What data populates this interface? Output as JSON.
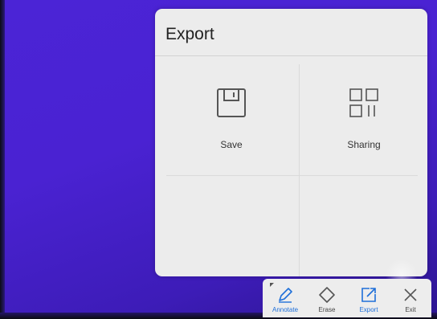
{
  "panel": {
    "title": "Export",
    "options": [
      {
        "label": "Save",
        "icon": "floppy-disk-icon"
      },
      {
        "label": "Sharing",
        "icon": "sharing-grid-icon"
      }
    ]
  },
  "toolbar": {
    "items": [
      {
        "label": "Annotate",
        "icon": "pen-icon",
        "active": true
      },
      {
        "label": "Erase",
        "icon": "eraser-icon",
        "active": false
      },
      {
        "label": "Export",
        "icon": "export-icon",
        "active": true
      },
      {
        "label": "Exit",
        "icon": "close-icon",
        "active": false
      }
    ]
  },
  "colors": {
    "background": "#4b24d6",
    "panel": "#ececec",
    "accent": "#1e6fd9",
    "icon_gray": "#555555"
  }
}
